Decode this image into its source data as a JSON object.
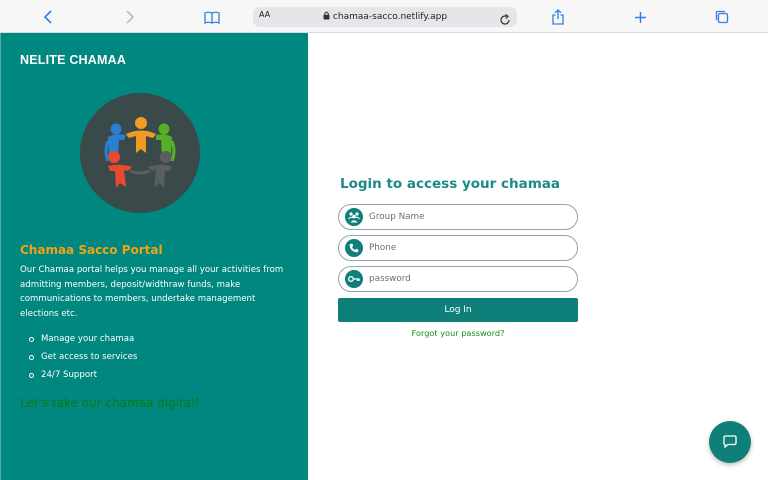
{
  "browser": {
    "text_size_label": "AA",
    "url": "chamaa-sacco.netlify.app",
    "icons": [
      "back-icon",
      "forward-icon",
      "bookmarks-icon",
      "lock-icon",
      "reload-icon",
      "share-icon",
      "new-tab-icon",
      "tabs-icon"
    ]
  },
  "sidebar": {
    "brand": "NELITE CHAMAA",
    "portal_title": "Chamaa Sacco Portal",
    "description": "Our Chamaa portal helps you manage all your activities from admitting members, deposit/widthraw funds, make communications to members, undertake management elections etc.",
    "features": [
      "Manage your chamaa",
      "Get access to services",
      "24/7 Support"
    ],
    "cta": "Let's take our chamaa digital!"
  },
  "login": {
    "title": "Login to access your chamaa",
    "fields": [
      {
        "placeholder": "Group Name",
        "icon": "group-icon",
        "value": ""
      },
      {
        "placeholder": "Phone",
        "icon": "phone-icon",
        "value": ""
      },
      {
        "placeholder": "password",
        "icon": "key-icon",
        "value": ""
      }
    ],
    "button": "Log In",
    "forgot": "Forgot your password?"
  },
  "chat": {
    "icon": "chat-icon"
  },
  "colors": {
    "primary_teal": "#00877f",
    "button_teal": "#0f8079",
    "accent_orange": "#f2a313",
    "link_green": "#178a1a",
    "cta_green": "#0c7a12",
    "title_teal": "#1a8a8a"
  }
}
